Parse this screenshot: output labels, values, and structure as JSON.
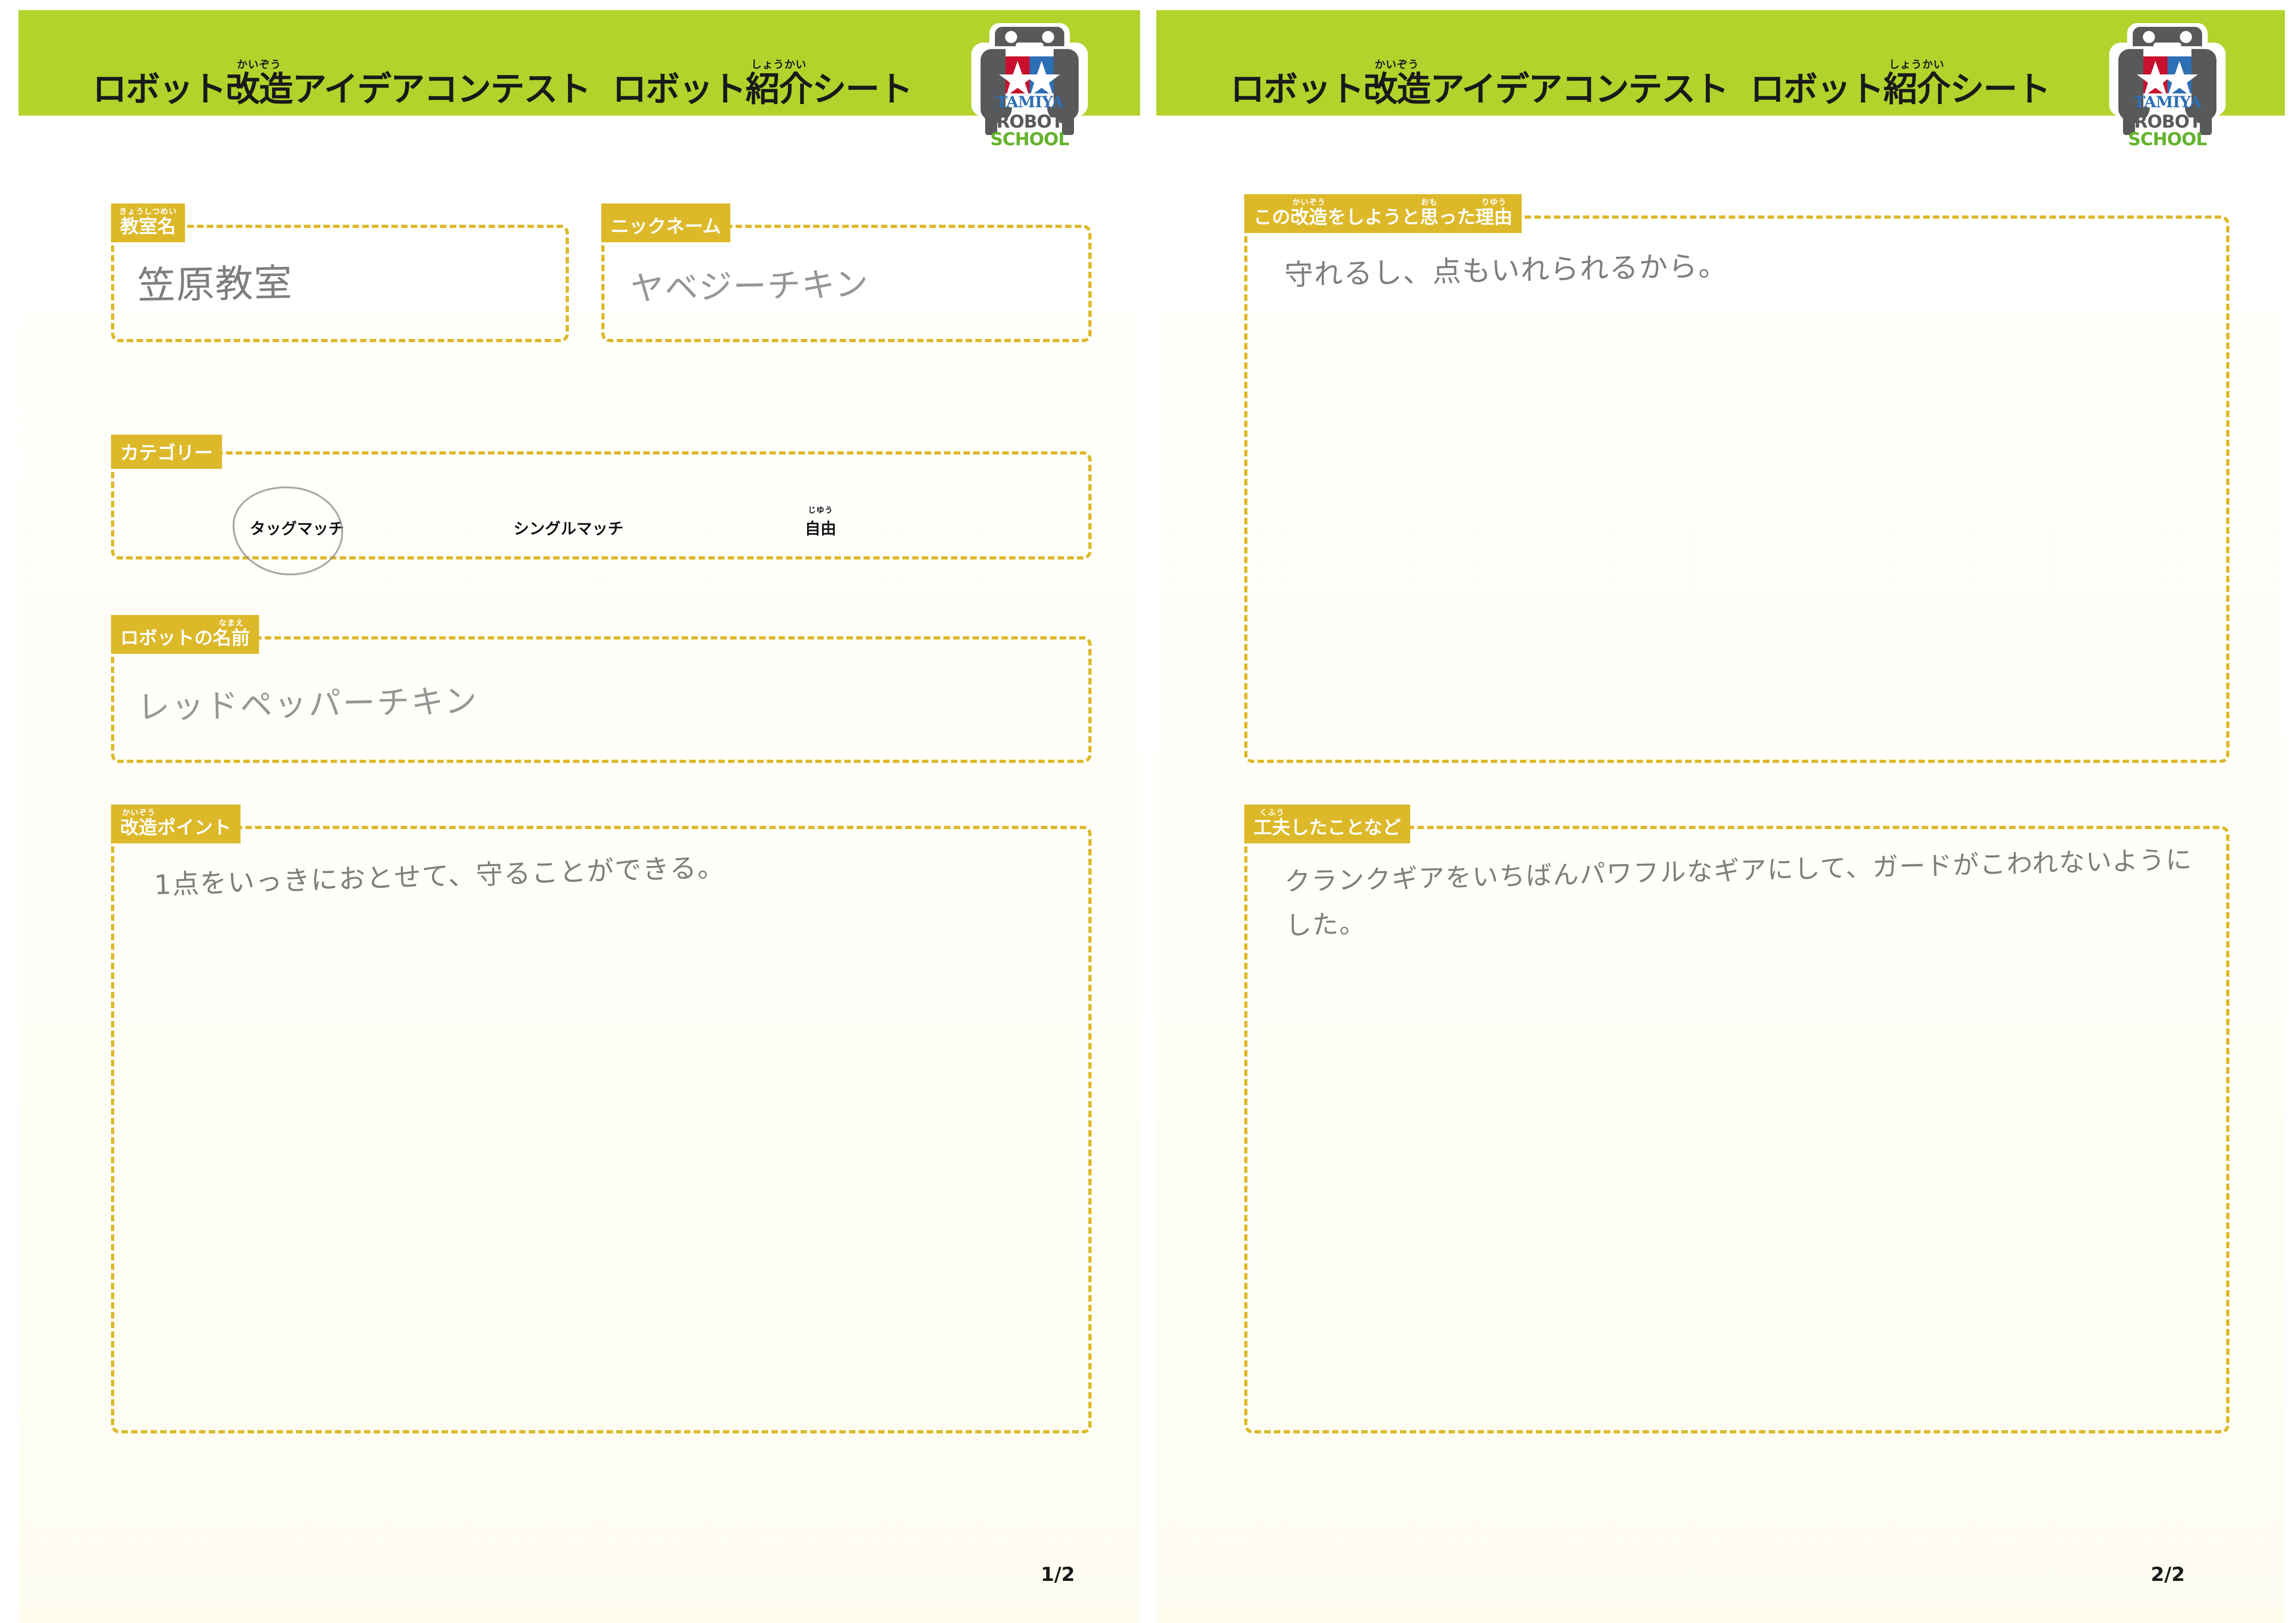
{
  "document": {
    "title": "ロボット改造アイデアコンテスト　ロボット紹介シート",
    "brand_logo_name": "TAMIYA ROBOT SCHOOL"
  },
  "colors": {
    "header_green": "#b2d32c",
    "label_gold": "#ddb92a",
    "tamiya_red": "#c8102e",
    "tamiya_blue": "#2d6fb5",
    "robot_gray": "#58595b",
    "school_green": "#63b32c",
    "handwriting": "#6d6d6d"
  },
  "logo": {
    "star_block": "twin-star",
    "line1": "TAMIYA",
    "line2": "ROBOT",
    "line3": "SCHOOL"
  },
  "header": {
    "title_part1_a": "ロボット",
    "title_part1_kanji": "改造",
    "title_part1_ruby": "かいぞう",
    "title_part1_b": "アイデアコンテスト",
    "title_part2_a": "ロボット",
    "title_part2_kanji": "紹介",
    "title_part2_ruby": "しょうかい",
    "title_part2_b": "シート"
  },
  "page_left": {
    "page_number": "1/2",
    "fields": {
      "classroom": {
        "label_kanji": "教室名",
        "label_ruby": "きょうしつめい",
        "value": "笠原教室"
      },
      "nickname": {
        "label": "ニックネーム",
        "value": "ヤベジーチキン"
      },
      "category": {
        "label": "カテゴリー",
        "options": [
          {
            "text": "タッグマッチ",
            "ruby": "",
            "selected": true
          },
          {
            "text": "シングルマッチ",
            "ruby": "",
            "selected": false
          },
          {
            "text": "自由",
            "ruby": "じゆう",
            "selected": false
          }
        ]
      },
      "robot_name": {
        "label_a": "ロボットの",
        "label_kanji": "名前",
        "label_ruby": "なまえ",
        "value": "レッドペッパーチキン"
      },
      "modification_points": {
        "label_kanji": "改造",
        "label_ruby": "かいぞう",
        "label_b": "ポイント",
        "value": "1点をいっきにおとせて、守ることができる。"
      }
    }
  },
  "page_right": {
    "page_number": "2/2",
    "fields": {
      "reason": {
        "label_a": "この",
        "label_kanji1": "改造",
        "label_ruby1": "かいぞう",
        "label_b": "をしようと",
        "label_kanji2": "思",
        "label_ruby2": "おも",
        "label_c": "った",
        "label_kanji3": "理由",
        "label_ruby3": "りゆう",
        "value": "守れるし、点もいれられるから。"
      },
      "ingenuity": {
        "label_kanji": "工夫",
        "label_ruby": "くふう",
        "label_b": "したことなど",
        "value": "クランクギアをいちばんパワフルなギアにして、ガードがこわれないようにした。"
      }
    }
  }
}
